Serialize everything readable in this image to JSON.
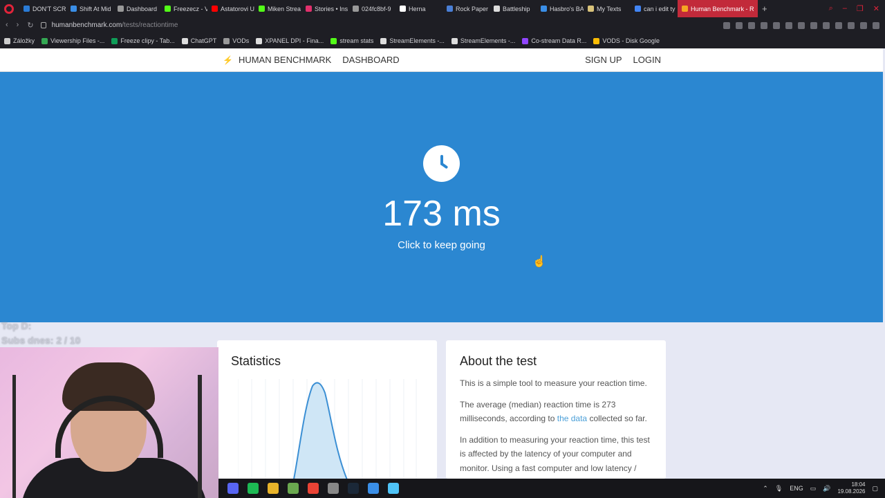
{
  "browser": {
    "tabs": [
      {
        "label": "DON'T SCRE",
        "color": "#2a7bd6"
      },
      {
        "label": "Shift At Mid",
        "color": "#3a8ee6"
      },
      {
        "label": "Dashboard",
        "color": "#999999"
      },
      {
        "label": "Freezecz - V",
        "color": "#53fc18"
      },
      {
        "label": "Astatorovi U",
        "color": "#ff0000"
      },
      {
        "label": "Miken Strea",
        "color": "#53fc18"
      },
      {
        "label": "Stories • Ins",
        "color": "#e1306c"
      },
      {
        "label": "024fc8bf-9",
        "color": "#999999"
      },
      {
        "label": "Herna",
        "color": "#ffffff"
      },
      {
        "label": "Rock Paper",
        "color": "#4a7fd6"
      },
      {
        "label": "Battleship",
        "color": "#dddddd"
      },
      {
        "label": "Hasbro's BA",
        "color": "#3a8ee6"
      },
      {
        "label": "My Texts",
        "color": "#d8c27a"
      },
      {
        "label": "can i edit ty",
        "color": "#4285f4"
      },
      {
        "label": "Human Benchmark - R",
        "color": "#f5a623"
      }
    ],
    "new_tab": "+",
    "url_host": "humanbenchmark.com",
    "url_path": "/tests/reactiontime",
    "bookmarks": [
      {
        "label": "Záložky",
        "color": "#cccccc"
      },
      {
        "label": "Viewership Files -...",
        "color": "#34a853"
      },
      {
        "label": "Freeze clipy - Tab...",
        "color": "#0f9d58"
      },
      {
        "label": "ChatGPT",
        "color": "#dddddd"
      },
      {
        "label": "VODs",
        "color": "#999999"
      },
      {
        "label": "XPANEL DPI - Fina...",
        "color": "#dddddd"
      },
      {
        "label": "stream stats",
        "color": "#53fc18"
      },
      {
        "label": "StreamElements -...",
        "color": "#dddddd"
      },
      {
        "label": "StreamElements -...",
        "color": "#dddddd"
      },
      {
        "label": "Co-stream Data R...",
        "color": "#9146ff"
      },
      {
        "label": "VODS - Disk Google",
        "color": "#fbbc04"
      }
    ]
  },
  "site": {
    "brand": "HUMAN BENCHMARK",
    "dashboard": "DASHBOARD",
    "sign_up": "SIGN UP",
    "login": "LOGIN"
  },
  "hero": {
    "result": "173 ms",
    "subtext": "Click to keep going",
    "bg_color": "#2b87d1"
  },
  "stats": {
    "title": "Statistics"
  },
  "about": {
    "title": "About the test",
    "p1": "This is a simple tool to measure your reaction time.",
    "p2_a": "The average (median) reaction time is 273 milliseconds, according to ",
    "p2_link": "the data",
    "p2_b": " collected so far.",
    "p3": "In addition to measuring your reaction time, this test is affected by the latency of your computer and monitor. Using a fast computer and low latency / high framerate monitor will improve"
  },
  "overlay": {
    "line1": "Top D:",
    "line2": "Subs dnes: 2 / 10"
  },
  "taskbar": {
    "apps": [
      {
        "name": "discord",
        "color": "#5865f2"
      },
      {
        "name": "spotify",
        "color": "#1db954"
      },
      {
        "name": "explorer",
        "color": "#e8b32a"
      },
      {
        "name": "app-green",
        "color": "#6aa84f"
      },
      {
        "name": "chrome",
        "color": "#ea4335"
      },
      {
        "name": "ccleaner",
        "color": "#888888"
      },
      {
        "name": "steam",
        "color": "#1b2838"
      },
      {
        "name": "app-blue",
        "color": "#3a8ee6"
      },
      {
        "name": "notepad",
        "color": "#4fc3f7"
      }
    ],
    "lang": "ENG",
    "time": "18:04",
    "date": "19.08.2026"
  }
}
